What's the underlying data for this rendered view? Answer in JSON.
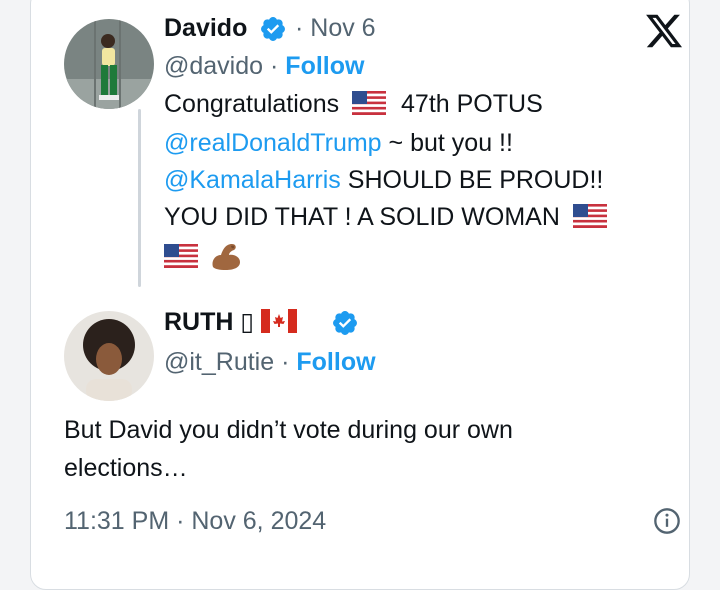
{
  "tweet": {
    "author": {
      "name": "Davido",
      "handle": "@davido",
      "date": "· Nov 6",
      "follow": "Follow"
    },
    "text": {
      "l1a": "Congratulations",
      "l1b": "47th POTUS",
      "l2_mention": "@realDonaldTrump",
      "l2_rest": "~ but you !!",
      "l3_mention": "@KamalaHarris",
      "l3_rest": "SHOULD BE PROUD!!",
      "l4": "YOU DID THAT ! A SOLID WOMAN"
    }
  },
  "reply": {
    "author": {
      "name": "RUTH",
      "name_glyph": "▯",
      "handle": "@it_Rutie",
      "follow": "Follow"
    },
    "text_l1": "But David you didn’t vote during our own",
    "text_l2": "elections…",
    "timestamp": "11:31 PM · Nov 6, 2024"
  },
  "icons": {
    "brand": "x-logo-icon",
    "verified": "verified-badge-icon",
    "info": "info-icon",
    "flag_us": "us-flag-icon",
    "flag_ca": "canada-flag-icon",
    "biceps": "flexed-biceps-icon"
  },
  "colors": {
    "accent": "#1d9bf0",
    "muted": "#536471",
    "text": "#0f1419"
  }
}
